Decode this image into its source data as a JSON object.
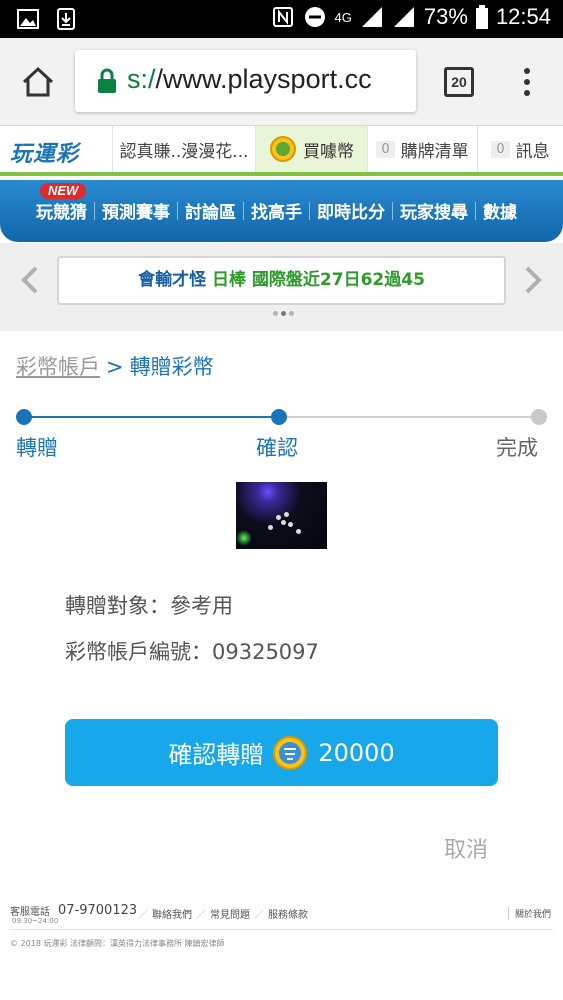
{
  "status_bar": {
    "battery": "73%",
    "time": "12:54",
    "network": "4G"
  },
  "browser": {
    "url_scheme_fragment": "s:/",
    "url_rest": "/www.playsport.cc",
    "tab_count": "20"
  },
  "site": {
    "logo": "玩運彩",
    "news_preview": "認真賺..漫漫花...",
    "buy_coins": "買噱幣",
    "plist_count": "0",
    "plist_label": "購牌清單",
    "msg_count": "0",
    "msg_label": "訊息",
    "new_tag": "NEW"
  },
  "main_menu": [
    "玩競猜",
    "預測賽事",
    "討論區",
    "找高手",
    "即時比分",
    "玩家搜尋",
    "數據"
  ],
  "ticker": {
    "part1": "會輸才怪",
    "part2": "日棒",
    "part3": "國際盤近27日62過45"
  },
  "breadcrumb": {
    "parent": "彩幣帳戶",
    "separator": ">",
    "current": "轉贈彩幣"
  },
  "steps": [
    "轉贈",
    "確認",
    "完成"
  ],
  "info": {
    "target": "轉贈對象：參考用",
    "account": "彩幣帳戶編號：09325097"
  },
  "confirm": {
    "label": "確認轉贈",
    "amount": "20000"
  },
  "cancel_label": "取消",
  "footer": {
    "service_label": "客服電話",
    "phone": "07-9700123",
    "hours": "09:30~24:00",
    "links": [
      "聯絡我們",
      "常見問題",
      "服務條款"
    ],
    "about": "關於我們",
    "copyright": "© 2018 玩運彩 法律顧問：漢英得力法律事務所 陳鎮宏律師"
  },
  "colors": {
    "brand_blue": "#1b73b8",
    "button_blue": "#16a8ea",
    "green": "#82c341",
    "ticker_green": "#2e9c2b"
  }
}
